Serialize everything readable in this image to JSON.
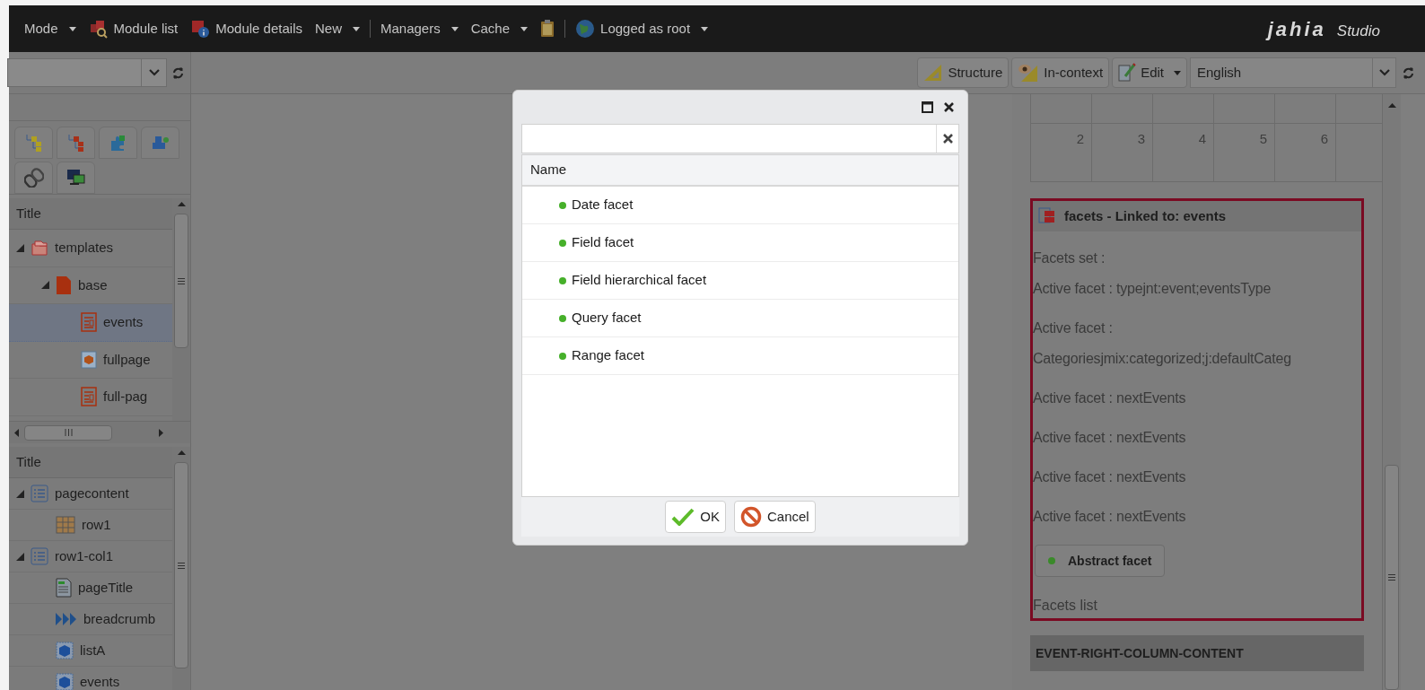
{
  "top_bar": {
    "mode_menu": "Mode",
    "module_list": "Module list",
    "module_details": "Module details",
    "new_menu": "New",
    "managers_menu": "Managers",
    "cache_menu": "Cache",
    "user_menu": "Logged as root",
    "logo": {
      "brand": "jahia",
      "product": "Studio"
    }
  },
  "content_tree": {
    "header": "Title",
    "items": [
      {
        "label": "templates",
        "kind": "folder",
        "expanded": true,
        "selected": false,
        "children": [
          {
            "label": "base",
            "kind": "page",
            "expanded": true,
            "selected": false,
            "children": [
              {
                "label": "events",
                "kind": "template",
                "selected": true
              },
              {
                "label": "fullpage",
                "kind": "module",
                "selected": false
              },
              {
                "label": "full-pag",
                "kind": "template",
                "selected": false
              }
            ]
          }
        ]
      }
    ]
  },
  "structure_tree": {
    "header": "Title",
    "items": [
      {
        "label": "pagecontent",
        "kind": "list",
        "expanded": true,
        "children": [
          {
            "label": "row1",
            "kind": "grid"
          }
        ]
      },
      {
        "label": "row1-col1",
        "kind": "list",
        "expanded": true,
        "children": [
          {
            "label": "pageTitle",
            "kind": "title"
          },
          {
            "label": "breadcrumb",
            "kind": "breadcrumb"
          },
          {
            "label": "listA",
            "kind": "box"
          },
          {
            "label": "events",
            "kind": "box"
          }
        ]
      }
    ]
  },
  "view_toolbar": {
    "modes": [
      {
        "label": "Structure",
        "kind": "structure"
      },
      {
        "label": "In-context",
        "kind": "in-context"
      }
    ],
    "edit_menu": "Edit",
    "language": "English"
  },
  "calendar": {
    "day_numbers": [
      "2",
      "3",
      "4",
      "5",
      "6"
    ]
  },
  "facets_module": {
    "title": "facets - Linked to: events",
    "paragraphs": [
      [
        "Facets set :",
        "Active facet : typejnt:event;eventsType"
      ],
      [
        "Active facet :",
        "Categoriesjmix:categorized;j:defaultCateg"
      ],
      [
        "Active facet : nextEvents"
      ],
      [
        "Active facet : nextEvents"
      ],
      [
        "Active facet : nextEvents"
      ],
      [
        "Active facet : nextEvents"
      ]
    ],
    "abstract_button": "Abstract facet",
    "footer": "Facets list"
  },
  "section_bar": "EVENT-RIGHT-COLUMN-CONTENT",
  "dialog": {
    "grid_header": "Name",
    "rows": [
      "Date facet",
      "Field facet",
      "Field hierarchical facet",
      "Query facet",
      "Range facet"
    ],
    "buttons": [
      {
        "label": "OK",
        "kind": "ok"
      },
      {
        "label": "Cancel",
        "kind": "cancel"
      }
    ]
  }
}
